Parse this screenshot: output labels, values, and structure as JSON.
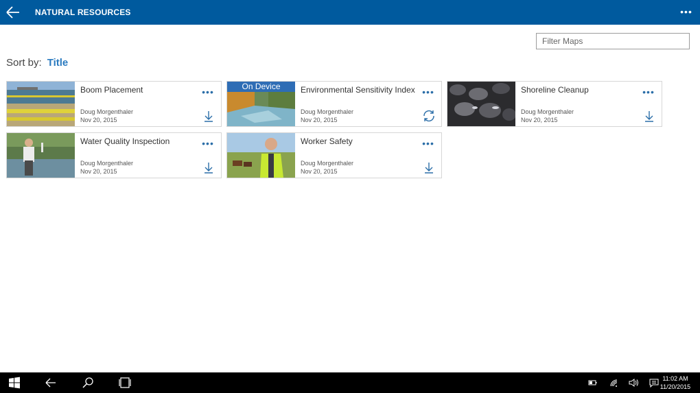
{
  "header": {
    "title": "NATURAL RESOURCES",
    "back_icon": "back-arrow-icon",
    "more_icon": "ellipsis-icon"
  },
  "filter": {
    "placeholder": "Filter Maps",
    "value": ""
  },
  "sort": {
    "label": "Sort by:",
    "value": "Title"
  },
  "colors": {
    "header_bg": "#005a9e",
    "accent": "#2b7bc0",
    "badge_bg": "#2e6db5"
  },
  "maps": [
    {
      "title": "Boom Placement",
      "owner": "Doug Morgenthaler",
      "date": "Nov 20, 2015",
      "action": "download-icon",
      "badge": ""
    },
    {
      "title": "Environmental Sensitivity Index",
      "owner": "Doug Morgenthaler",
      "date": "Nov 20, 2015",
      "action": "sync-icon",
      "badge": "On Device"
    },
    {
      "title": "Shoreline Cleanup",
      "owner": "Doug Morgenthaler",
      "date": "Nov 20, 2015",
      "action": "download-icon",
      "badge": ""
    },
    {
      "title": "Water Quality Inspection",
      "owner": "Doug Morgenthaler",
      "date": "Nov 20, 2015",
      "action": "download-icon",
      "badge": ""
    },
    {
      "title": "Worker Safety",
      "owner": "Doug Morgenthaler",
      "date": "Nov 20, 2015",
      "action": "download-icon",
      "badge": ""
    }
  ],
  "taskbar": {
    "time": "11:02 AM",
    "date": "11/20/2015",
    "icons": [
      "windows-start-icon",
      "back-icon",
      "search-icon",
      "task-view-icon",
      "battery-icon",
      "wifi-icon",
      "volume-icon",
      "action-center-icon"
    ]
  }
}
